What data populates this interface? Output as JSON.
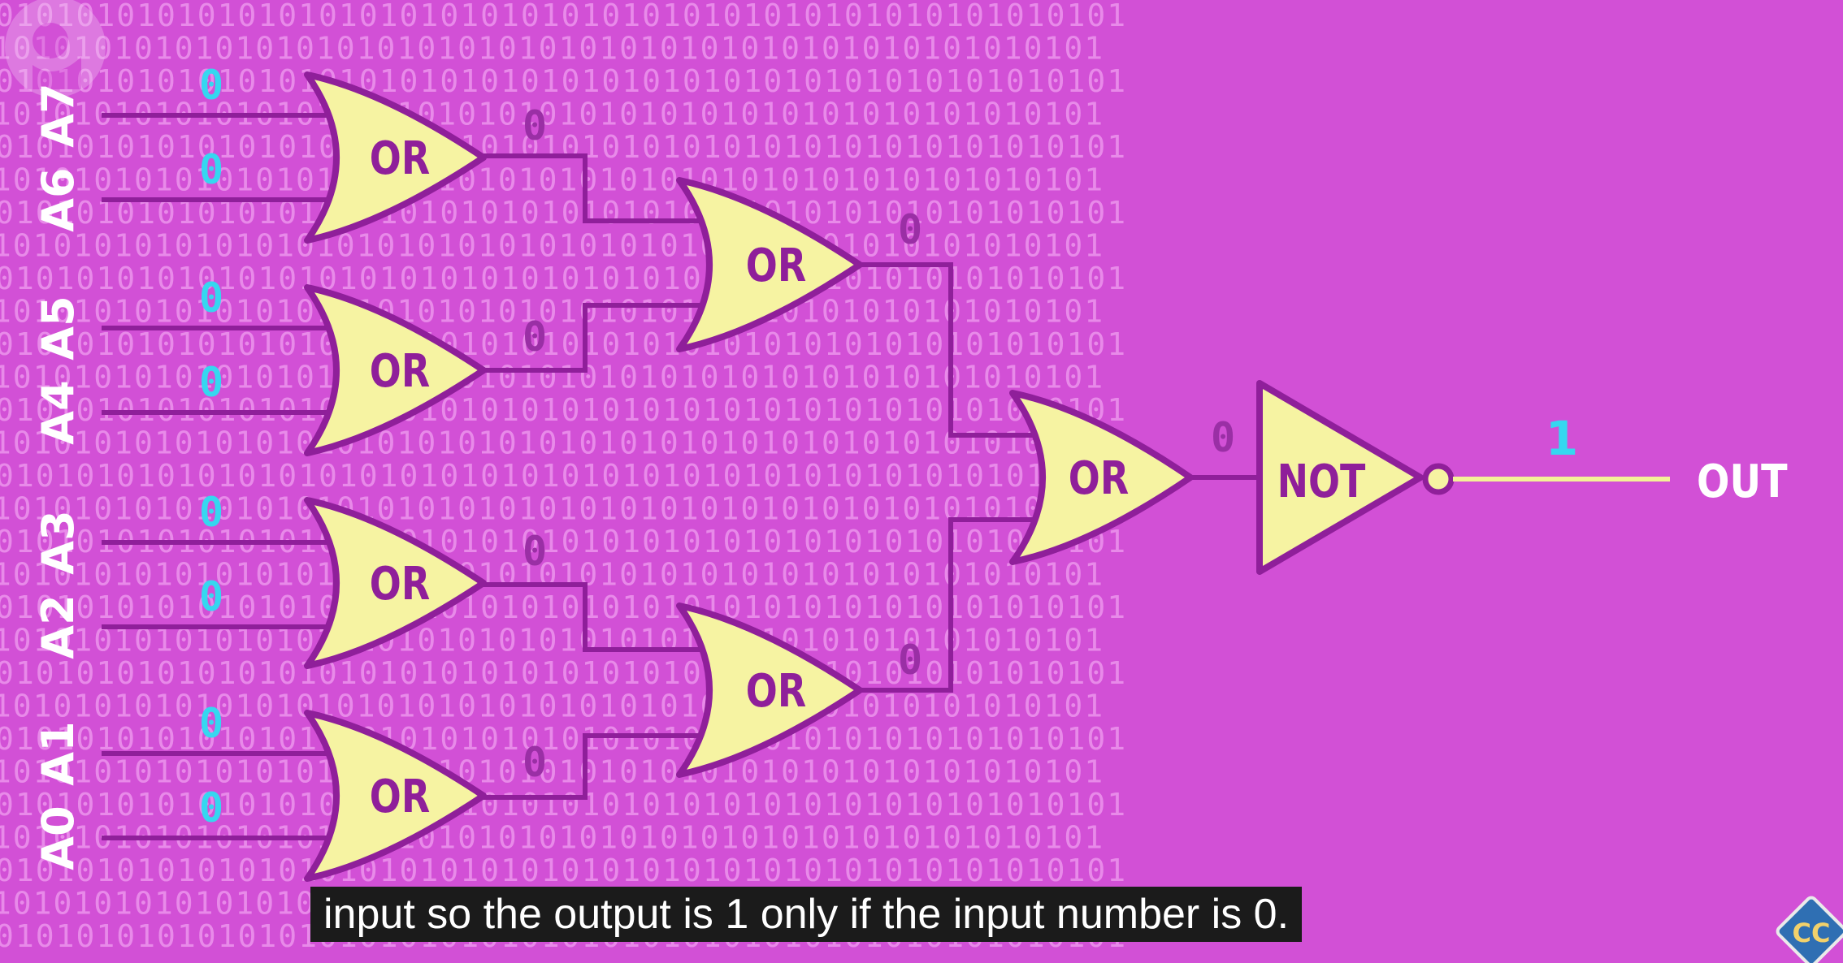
{
  "inputs": [
    {
      "label": "A7",
      "bit": "0"
    },
    {
      "label": "A6",
      "bit": "0"
    },
    {
      "label": "A5",
      "bit": "0"
    },
    {
      "label": "A4",
      "bit": "0"
    },
    {
      "label": "A3",
      "bit": "0"
    },
    {
      "label": "A2",
      "bit": "0"
    },
    {
      "label": "A1",
      "bit": "0"
    },
    {
      "label": "A0",
      "bit": "0"
    }
  ],
  "gates": {
    "or_label": "OR",
    "not_label": "NOT"
  },
  "wire_bits": {
    "or1": "0",
    "or2": "0",
    "or3": "0",
    "or4": "0",
    "or5": "0",
    "or6": "0",
    "or7": "0"
  },
  "output": {
    "bit": "1",
    "label": "OUT"
  },
  "caption": "input so the output is 1 only if the input number is 0.",
  "background_pattern": "01010101010101010101010101010101010101010101010101010101",
  "icons": {
    "watermark": "pbs-logo-icon",
    "corner": "cc-logo-icon",
    "corner_text": "CC"
  },
  "colors": {
    "background": "#d250d6",
    "gate_fill": "#f6f3a2",
    "wire": "#8f1f9a",
    "input_bits": "#35d7f0",
    "caption_bg": "#1b1b1b"
  }
}
